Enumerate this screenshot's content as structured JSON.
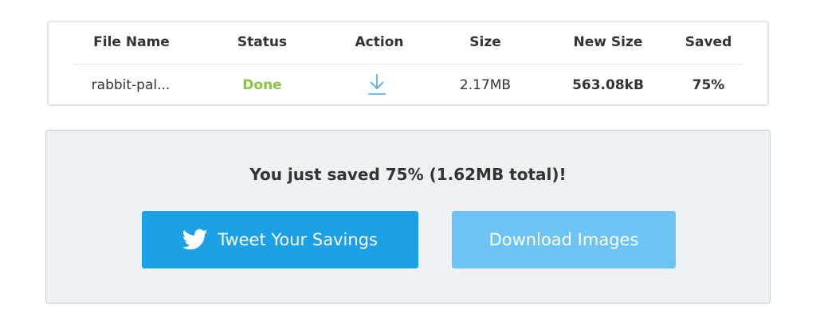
{
  "table": {
    "headers": {
      "file_name": "File Name",
      "status": "Status",
      "action": "Action",
      "size": "Size",
      "new_size": "New Size",
      "saved": "Saved"
    },
    "rows": [
      {
        "file_name": "rabbit-pal...",
        "status": "Done",
        "action_icon": "download-icon",
        "size": "2.17MB",
        "new_size": "563.08kB",
        "saved": "75%"
      }
    ]
  },
  "savings": {
    "message": "You just saved 75% (1.62MB total)!",
    "tweet_label": "Tweet Your Savings",
    "tweet_icon": "twitter-bird-icon",
    "download_label": "Download Images"
  },
  "colors": {
    "status_done": "#8bc34a",
    "tweet_button": "#1da1e6",
    "download_button": "#6ec3f5",
    "download_icon": "#45a8e6"
  }
}
